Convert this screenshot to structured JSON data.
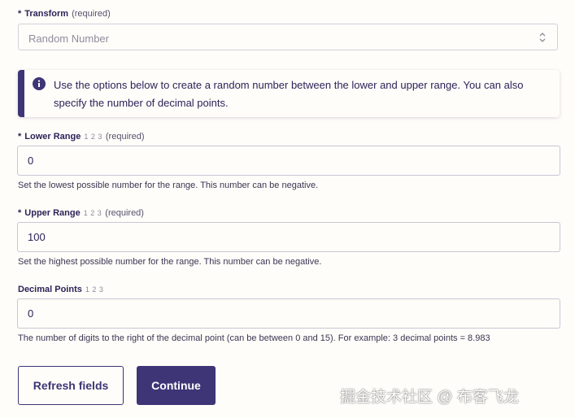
{
  "transform": {
    "required_star": "*",
    "label": "Transform",
    "required_text": "(required)",
    "selected_value": "Random Number"
  },
  "info": {
    "icon": "info-icon",
    "text": "Use the options below to create a random number between the lower and upper range. You can also specify the number of decimal points."
  },
  "lower_range": {
    "required_star": "*",
    "label": "Lower Range",
    "num_icon": "1 2 3",
    "required_text": "(required)",
    "value": "0",
    "help": "Set the lowest possible number for the range. This number can be negative."
  },
  "upper_range": {
    "required_star": "*",
    "label": "Upper Range",
    "num_icon": "1 2 3",
    "required_text": "(required)",
    "value": "100",
    "help": "Set the highest possible number for the range. This number can be negative."
  },
  "decimal_points": {
    "label": "Decimal Points",
    "num_icon": "1 2 3",
    "value": "0",
    "help": "The number of digits to the right of the decimal point (can be between 0 and 15). For example: 3 decimal points = 8.983"
  },
  "buttons": {
    "refresh": "Refresh fields",
    "continue": "Continue"
  },
  "watermark": "掘金技术社区 @ 布客飞龙",
  "colors": {
    "accent": "#3d3576",
    "background": "#fffdf9",
    "text": "#2b2358"
  }
}
